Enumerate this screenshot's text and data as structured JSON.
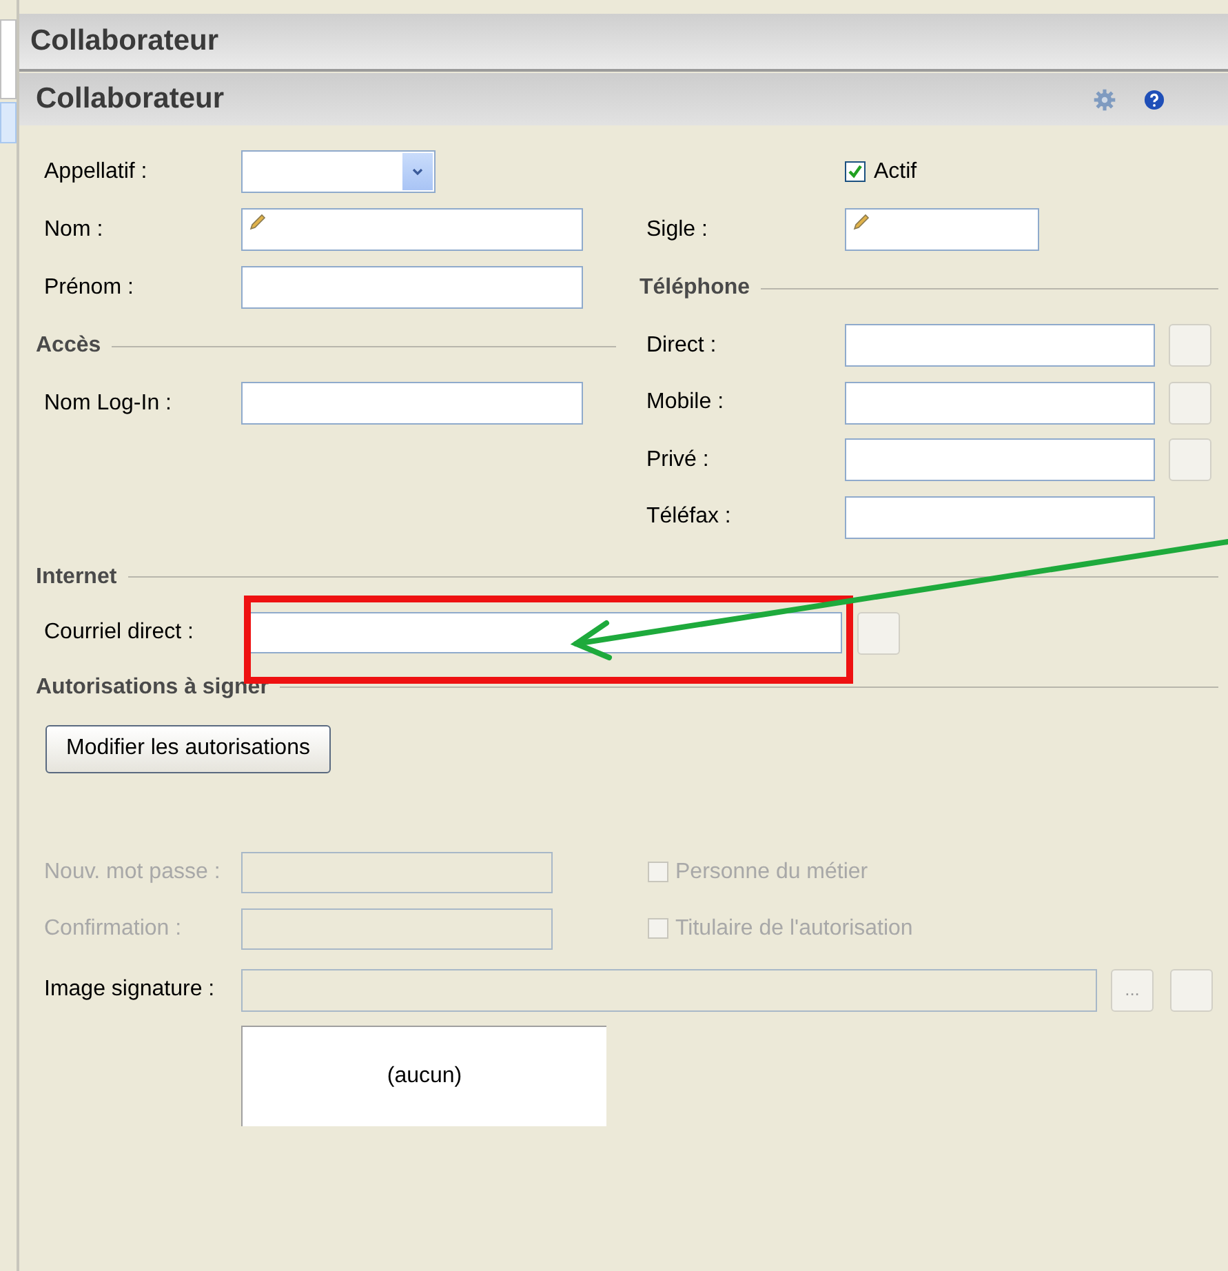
{
  "panel_title": "Collaborateur",
  "header": {
    "title": "Collaborateur"
  },
  "top_left": [
    {
      "kind": "dropdown",
      "label": "Appellatif :"
    },
    {
      "kind": "pencil",
      "label": "Nom :"
    },
    {
      "kind": "text",
      "label": "Prénom :"
    },
    {
      "kind": "heading",
      "label": "Accès"
    },
    {
      "kind": "text",
      "label": "Nom Log-In :"
    }
  ],
  "top_right": [
    {
      "kind": "checkbox",
      "label": "Actif",
      "checked": true
    },
    {
      "kind": "pencil",
      "label": "Sigle :"
    },
    {
      "kind": "heading",
      "label": "Téléphone"
    },
    {
      "kind": "text",
      "label": "Direct :",
      "side_button": true
    },
    {
      "kind": "text",
      "label": "Mobile :",
      "side_button": true
    },
    {
      "kind": "text",
      "label": "Privé :",
      "side_button": true
    },
    {
      "kind": "text",
      "label": "Téléfax :",
      "side_button": false
    }
  ],
  "internet": {
    "heading": "Internet",
    "label": "Courriel direct :",
    "side_button": true
  },
  "authorizations": {
    "heading": "Autorisations à signer",
    "button": "Modifier les autorisations"
  },
  "password_rows": [
    {
      "label": "Nouv. mot passe :",
      "disabled": true,
      "checkbox": {
        "label": "Personne du métier",
        "checked": false,
        "disabled": true
      }
    },
    {
      "label": "Confirmation :",
      "disabled": true,
      "checkbox": {
        "label": "Titulaire de l'autorisation",
        "checked": false,
        "disabled": true
      }
    }
  ],
  "signature": {
    "label": "Image signature :",
    "browse_button": "...",
    "preview": "(aucun)"
  }
}
